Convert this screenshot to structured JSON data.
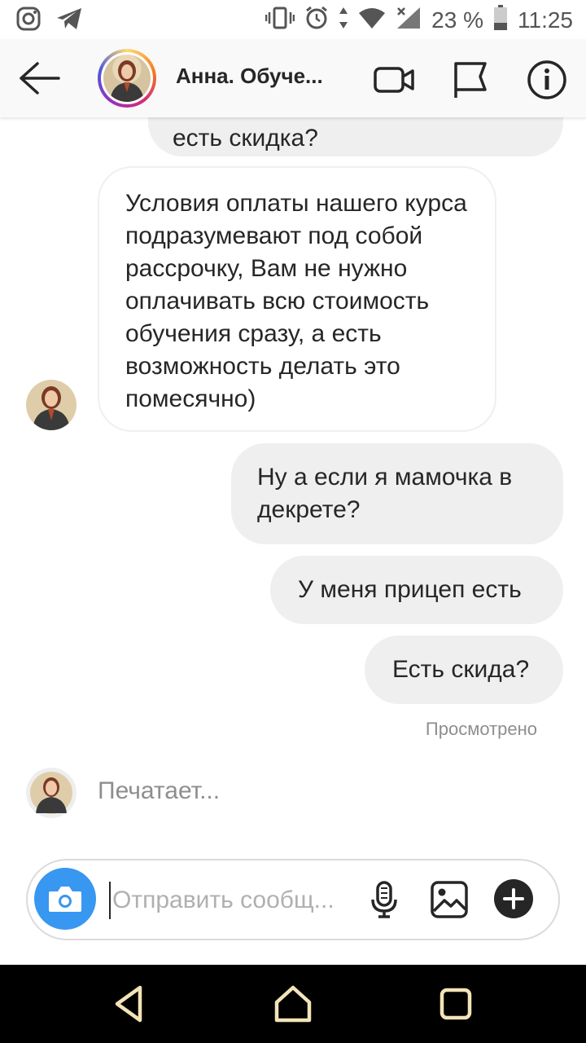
{
  "status_bar": {
    "battery_percent": "23 %",
    "time": "11:25"
  },
  "header": {
    "contact_name": "Анна. Обуче...",
    "video_call_icon": "video-camera-icon",
    "flag_icon": "flag-icon",
    "info_icon": "info-icon"
  },
  "messages": [
    {
      "id": "m0",
      "direction": "outgoing",
      "text": "есть скидка?"
    },
    {
      "id": "m1",
      "direction": "incoming",
      "text": "Условия оплаты нашего курса подразумевают под собой рассрочку, Вам не нужно оплачивать всю стоимость обучения сразу, а есть возможность делать это помесячно)"
    },
    {
      "id": "m2",
      "direction": "outgoing",
      "text": "Ну а если я мамочка в декрете?"
    },
    {
      "id": "m3",
      "direction": "outgoing",
      "text": "У меня прицеп есть"
    },
    {
      "id": "m4",
      "direction": "outgoing",
      "text": "Есть скида?"
    }
  ],
  "seen_label": "Просмотрено",
  "typing_label": "Печатает...",
  "composer": {
    "placeholder": "Отправить сообщ...",
    "value": ""
  },
  "colors": {
    "accent_blue": "#3897f0",
    "outgoing_bubble": "#efefef",
    "muted_text": "#8e8e8e"
  }
}
